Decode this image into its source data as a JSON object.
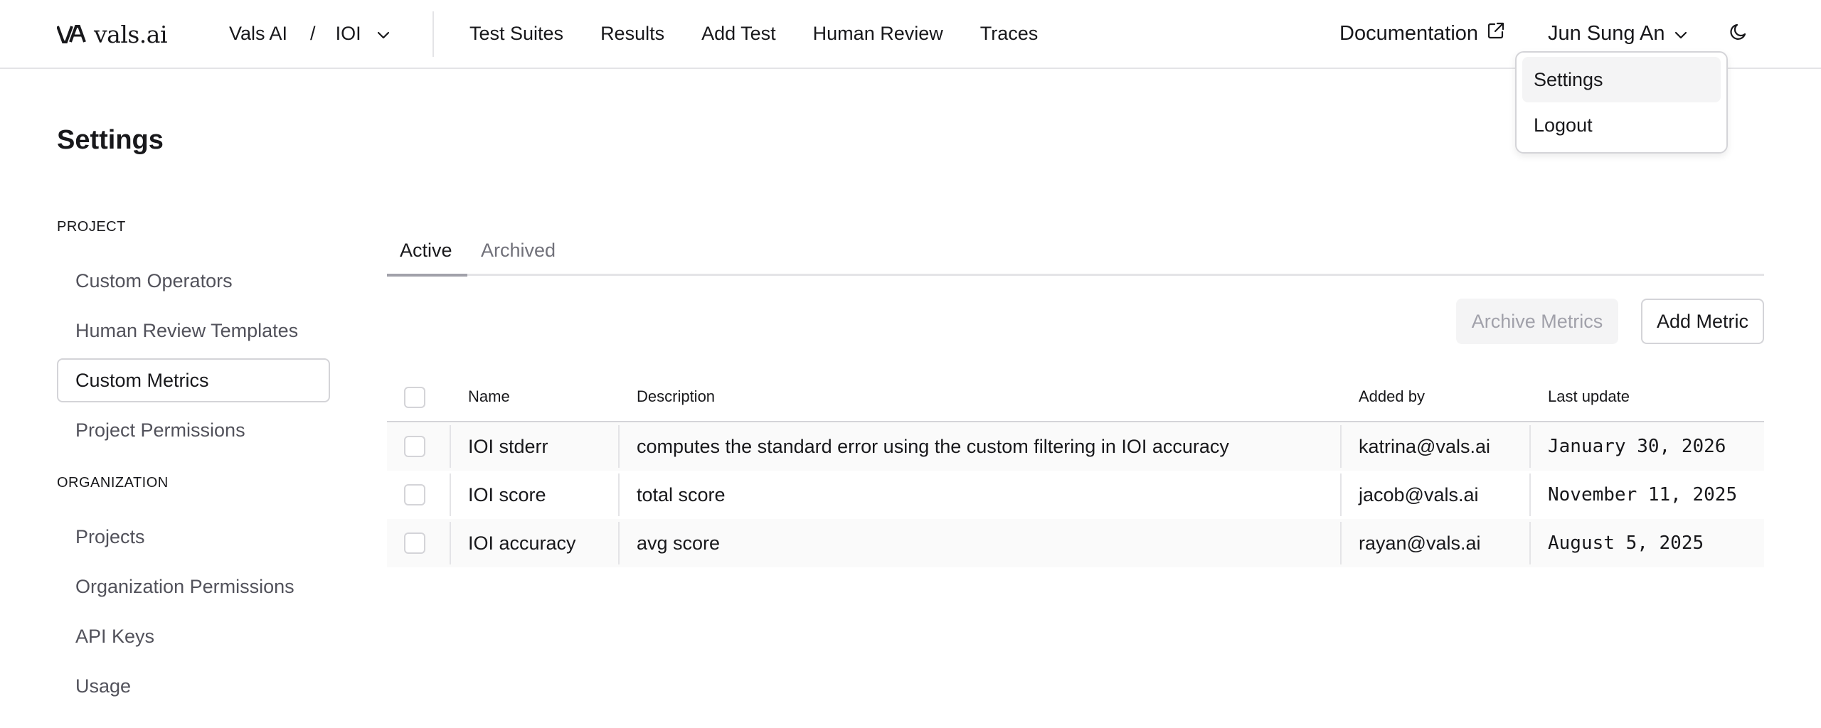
{
  "header": {
    "logo_text": "vals.ai",
    "breadcrumb": {
      "org": "Vals AI",
      "separator": "/",
      "project": "IOI"
    },
    "nav": [
      "Test Suites",
      "Results",
      "Add Test",
      "Human Review",
      "Traces"
    ],
    "documentation_label": "Documentation",
    "user_name": "Jun Sung An"
  },
  "user_menu": {
    "items": [
      "Settings",
      "Logout"
    ],
    "highlighted": "Settings"
  },
  "page": {
    "title": "Settings"
  },
  "sidebar": {
    "project_label": "PROJECT",
    "project_items": [
      "Custom Operators",
      "Human Review Templates",
      "Custom Metrics",
      "Project Permissions"
    ],
    "active_item": "Custom Metrics",
    "organization_label": "ORGANIZATION",
    "organization_items": [
      "Projects",
      "Organization Permissions",
      "API Keys",
      "Usage"
    ]
  },
  "tabs": {
    "items": [
      "Active",
      "Archived"
    ],
    "selected": "Active"
  },
  "actions": {
    "archive_label": "Archive Metrics",
    "add_label": "Add Metric"
  },
  "table": {
    "headers": [
      "Name",
      "Description",
      "Added by",
      "Last update"
    ],
    "rows": [
      {
        "name": "IOI stderr",
        "description": "computes the standard error using the custom filtering in IOI accuracy",
        "added_by": "katrina@vals.ai",
        "last_update": "January 30, 2026"
      },
      {
        "name": "IOI score",
        "description": "total score",
        "added_by": "jacob@vals.ai",
        "last_update": "November 11, 2025"
      },
      {
        "name": "IOI accuracy",
        "description": "avg score",
        "added_by": "rayan@vals.ai",
        "last_update": "August 5, 2025"
      }
    ]
  },
  "colors": {
    "text": "#18181b",
    "muted": "#52525b",
    "border": "#d4d4d8",
    "row_shade": "#fafafa"
  },
  "icons": [
    "vals-logo-icon",
    "chevron-down-icon",
    "external-link-icon",
    "moon-icon"
  ]
}
